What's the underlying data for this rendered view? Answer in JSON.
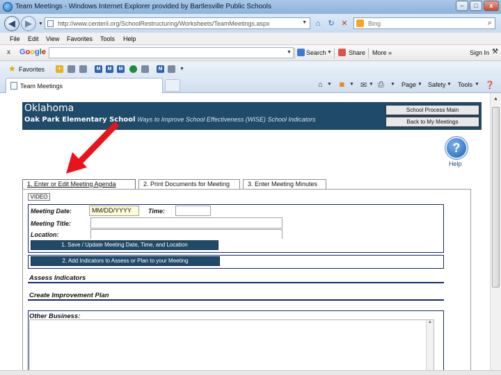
{
  "window": {
    "title": "Team Meetings - Windows Internet Explorer provided by Bartlesville Public Schools",
    "minimize": "–",
    "maximize": "□",
    "close": "x"
  },
  "address_bar": {
    "url": "http://www.centeril.org/SchoolRestructuring/Worksheets/TeamMeetings.aspx",
    "search_placeholder": "Bing"
  },
  "menu": [
    "File",
    "Edit",
    "View",
    "Favorites",
    "Tools",
    "Help"
  ],
  "google_toolbar": {
    "logo": [
      "G",
      "o",
      "o",
      "g",
      "l",
      "e"
    ],
    "search": "Search",
    "share": "Share",
    "more": "More »",
    "sign_in": "Sign In"
  },
  "favorites_bar": {
    "label": "Favorites"
  },
  "tab": {
    "title": "Team Meetings"
  },
  "command_bar": {
    "page": "Page",
    "safety": "Safety",
    "tools": "Tools"
  },
  "page": {
    "state": "Oklahoma",
    "school": "Oak Park Elementary School",
    "wise": "Ways to Improve School Effectiveness (WISE)",
    "indicators": "School Indicators",
    "buttons": {
      "school_process": "School Process Main",
      "back": "Back to My Meetings"
    },
    "help": "Help",
    "tabs": [
      "1.  Enter or Edit Meeting Agenda",
      "2. Print Documents for Meeting",
      "3. Enter Meeting Minutes"
    ],
    "video": "VIDEO",
    "form": {
      "date_label": "Meeting Date:",
      "date_value": "MM/DD/YYYY",
      "time_label": "Time:",
      "title_label": "Meeting Title:",
      "location_label": "Location:",
      "save_button": "1. Save / Update Meeting Date, Time, and Location",
      "add_indicators_button": "2. Add Indicators to Assess or Plan to your Meeting",
      "assess": "Assess Indicators",
      "create_plan": "Create Improvement Plan",
      "other_business": "Other Business:"
    }
  },
  "colors": {
    "banner": "#1f4a69",
    "pointer_arrow": "#e8141a",
    "form_border": "#16256c"
  }
}
